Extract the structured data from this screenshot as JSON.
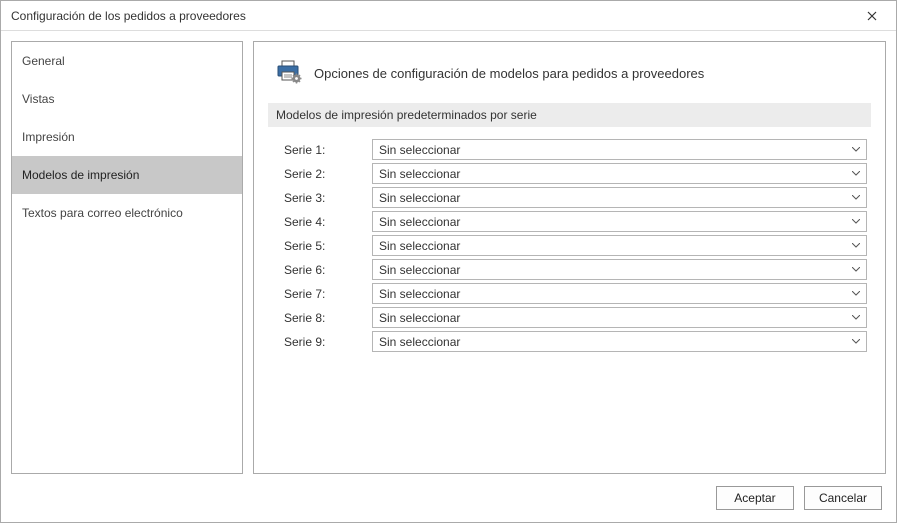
{
  "window": {
    "title": "Configuración de los pedidos a proveedores"
  },
  "sidebar": {
    "items": [
      {
        "label": "General"
      },
      {
        "label": "Vistas"
      },
      {
        "label": "Impresión"
      },
      {
        "label": "Modelos de impresión"
      },
      {
        "label": "Textos para correo electrónico"
      }
    ],
    "selected_index": 3
  },
  "main": {
    "heading": "Opciones de configuración de modelos para pedidos a proveedores",
    "section_title": "Modelos de impresión predeterminados por serie",
    "rows": [
      {
        "label": "Serie 1:",
        "value": "Sin seleccionar"
      },
      {
        "label": "Serie 2:",
        "value": "Sin seleccionar"
      },
      {
        "label": "Serie 3:",
        "value": "Sin seleccionar"
      },
      {
        "label": "Serie 4:",
        "value": "Sin seleccionar"
      },
      {
        "label": "Serie 5:",
        "value": "Sin seleccionar"
      },
      {
        "label": "Serie 6:",
        "value": "Sin seleccionar"
      },
      {
        "label": "Serie 7:",
        "value": "Sin seleccionar"
      },
      {
        "label": "Serie 8:",
        "value": "Sin seleccionar"
      },
      {
        "label": "Serie 9:",
        "value": "Sin seleccionar"
      }
    ]
  },
  "footer": {
    "accept_label": "Aceptar",
    "cancel_label": "Cancelar"
  }
}
